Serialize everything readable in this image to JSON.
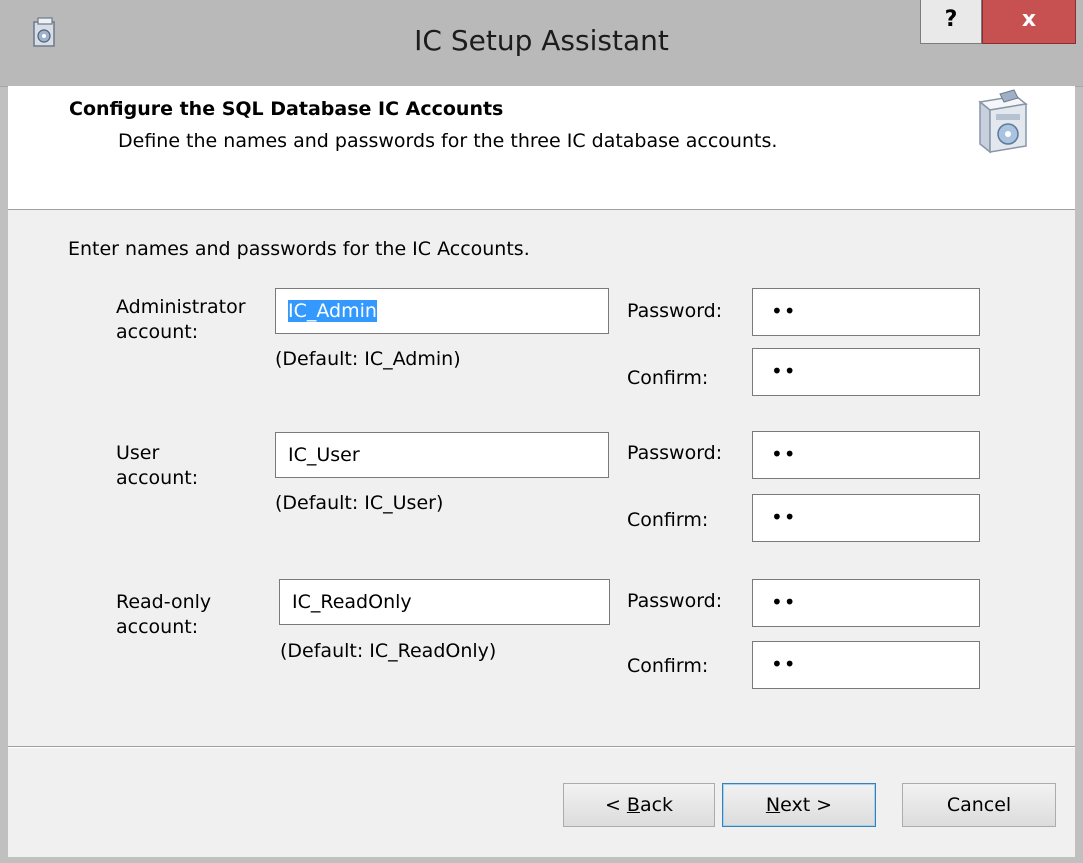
{
  "window": {
    "title": "IC Setup Assistant",
    "help_label": "?",
    "close_label": "x"
  },
  "header": {
    "title": "Configure the SQL Database IC Accounts",
    "subtitle": "Define the names and passwords for the three IC database accounts."
  },
  "intro": "Enter names and passwords for the IC Accounts.",
  "password_label": "Password:",
  "confirm_label": "Confirm:",
  "accounts": [
    {
      "label_line1": "Administrator",
      "label_line2": "account:",
      "value": "IC_Admin",
      "default_text": "(Default: IC_Admin)",
      "password": "••",
      "confirm": "••"
    },
    {
      "label_line1": "User",
      "label_line2": "account:",
      "value": "IC_User",
      "default_text": "(Default: IC_User)",
      "password": "••",
      "confirm": "••"
    },
    {
      "label_line1": "Read-only",
      "label_line2": "account:",
      "value": "IC_ReadOnly",
      "default_text": "(Default: IC_ReadOnly)",
      "password": "••",
      "confirm": "••"
    }
  ],
  "buttons": {
    "back_pre": "< ",
    "back_mnemonic": "B",
    "back_post": "ack",
    "next_mnemonic": "N",
    "next_post": "ext >",
    "cancel": "Cancel"
  },
  "icons": {
    "app": "setup-assistant-icon",
    "header": "software-box-icon"
  },
  "colors": {
    "selection": "#3399ff",
    "close": "#c75050"
  }
}
